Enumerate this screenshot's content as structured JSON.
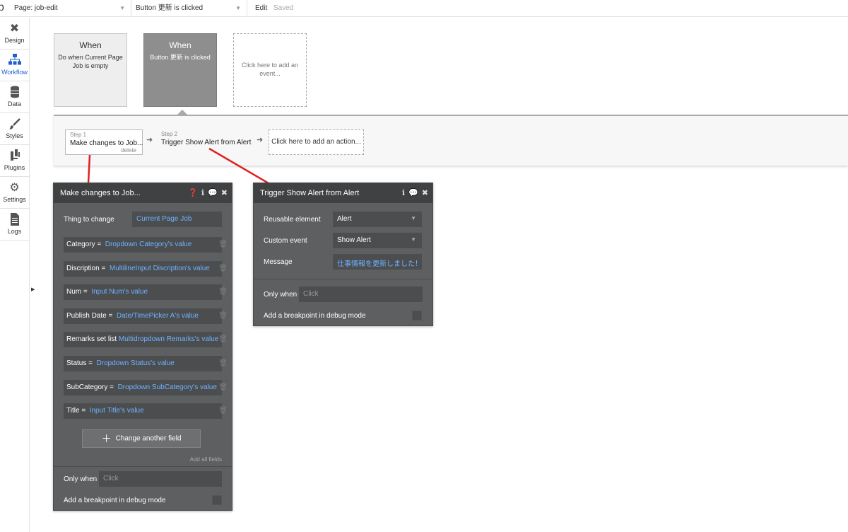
{
  "topbar": {
    "logo": "b",
    "page_select": "Page: job-edit",
    "event_select": "Button 更新 is clicked",
    "edit_label": "Edit",
    "saved_label": "Saved"
  },
  "sidebar": {
    "items": [
      {
        "label": "Design",
        "icon": "design-icon"
      },
      {
        "label": "Workflow",
        "icon": "workflow-icon"
      },
      {
        "label": "Data",
        "icon": "database-icon"
      },
      {
        "label": "Styles",
        "icon": "brush-icon"
      },
      {
        "label": "Plugins",
        "icon": "plug-icon"
      },
      {
        "label": "Settings",
        "icon": "gear-icon"
      },
      {
        "label": "Logs",
        "icon": "document-icon"
      }
    ]
  },
  "events": [
    {
      "when": "When",
      "desc": "Do when Current Page Job is empty"
    },
    {
      "when": "When",
      "desc": "Button 更新 is clicked"
    },
    {
      "desc": "Click here to add an event..."
    }
  ],
  "actions": {
    "step1": {
      "num": "Step 1",
      "title": "Make changes to Job...",
      "delete": "delete"
    },
    "step2": {
      "num": "Step 2",
      "title": "Trigger Show Alert from Alert"
    },
    "add": "Click here to add an action..."
  },
  "panel1": {
    "title": "Make changes to Job...",
    "thing_label": "Thing to change",
    "thing_value": "Current Page Job",
    "fields": [
      {
        "key": "Category",
        "eq": "=",
        "value": "Dropdown Category's value"
      },
      {
        "key": "Discription",
        "eq": "=",
        "value": "MultilineInput Discription's value"
      },
      {
        "key": "Num",
        "eq": "=",
        "value": "Input Num's value"
      },
      {
        "key": "Publish Date",
        "eq": "=",
        "value": "Date/TimePicker A's value"
      },
      {
        "key": "Remarks set list",
        "eq": "",
        "value": "Multidropdown Remarks's value"
      },
      {
        "key": "Status",
        "eq": "=",
        "value": "Dropdown Status's value"
      },
      {
        "key": "SubCategory",
        "eq": "=",
        "value": "Dropdown SubCategory's value"
      },
      {
        "key": "Title",
        "eq": "=",
        "value": "Input Title's value"
      }
    ],
    "change_another": "Change another field",
    "add_all": "Add all fields",
    "only_when_label": "Only when",
    "only_when_placeholder": "Click",
    "breakpoint_label": "Add a breakpoint in debug mode"
  },
  "panel2": {
    "title": "Trigger Show Alert from Alert",
    "reusable_label": "Reusable element",
    "reusable_value": "Alert",
    "custom_event_label": "Custom event",
    "custom_event_value": "Show Alert",
    "message_label": "Message",
    "message_value": "仕事情報を更新しました！",
    "only_when_label": "Only when",
    "only_when_placeholder": "Click",
    "breakpoint_label": "Add a breakpoint in debug mode"
  },
  "colors": {
    "accent": "#1f5fce",
    "panel_bg": "#5d5f61",
    "panel_header": "#3f4143",
    "link_value": "#6fb3ff",
    "connector": "#e02020"
  }
}
